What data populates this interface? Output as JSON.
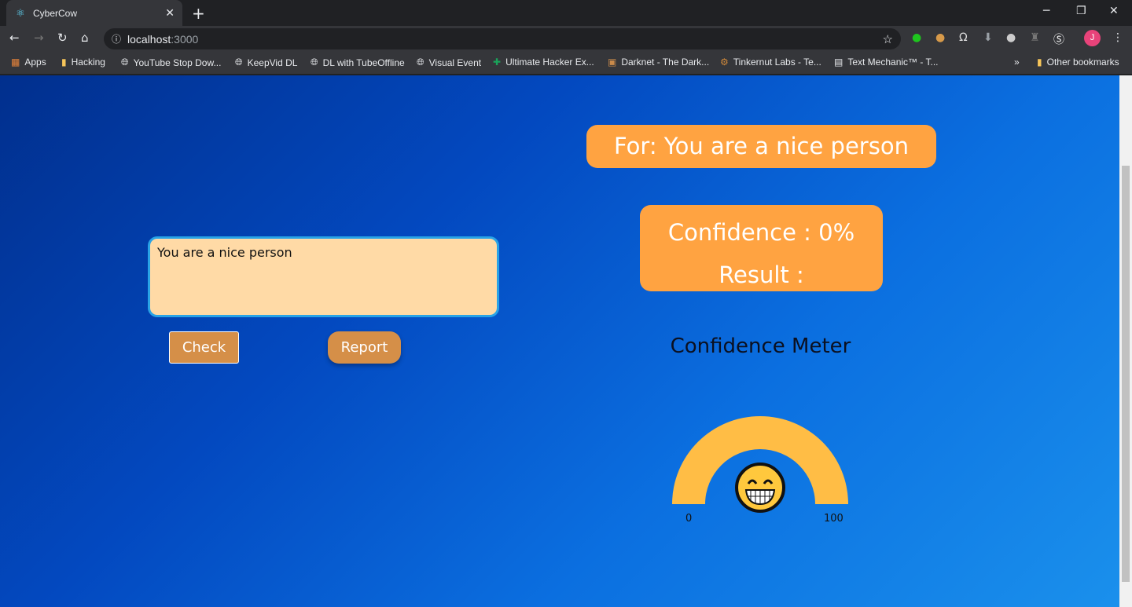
{
  "browser": {
    "tab_title": "CyberCow",
    "url_host": "localhost",
    "url_port": ":3000",
    "profile_initial": "J",
    "bookmarks": [
      "Apps",
      "Hacking",
      "YouTube Stop Dow...",
      "KeepVid DL",
      "DL with TubeOffline",
      "Visual Event",
      "Ultimate Hacker Ex...",
      "Darknet - The Dark...",
      "Tinkernut Labs - Te...",
      "Text Mechanic™ - T..."
    ],
    "overflow": "»",
    "other_bookmarks": "Other bookmarks"
  },
  "app": {
    "input_value": "You are a nice person",
    "check_label": "Check",
    "report_label": "Report",
    "for_text": "For: You are a nice person",
    "confidence_text": "Confidence : 0%",
    "result_text": "Result :",
    "meter_title": "Confidence Meter",
    "meter_min": "0",
    "meter_max": "100",
    "confidence_value": 0,
    "gauge_color": "#ffbd45",
    "accent_button": "#d58f48",
    "pill_color": "#ffa341",
    "emoji_icon": "grinning-face"
  }
}
